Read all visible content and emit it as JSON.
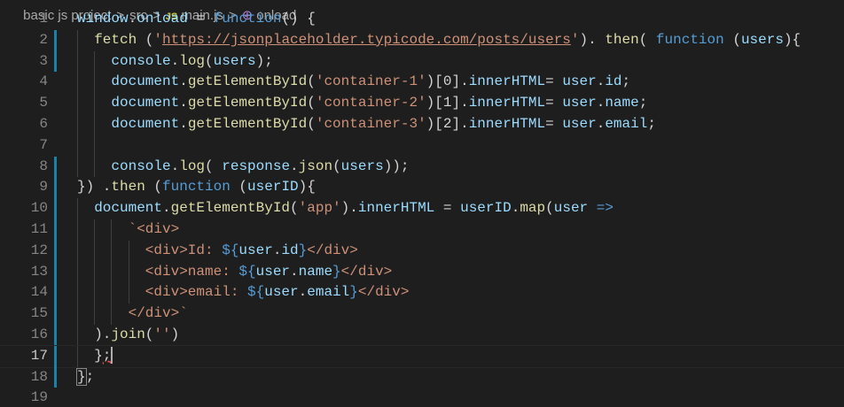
{
  "breadcrumb": {
    "items": [
      "basic js project",
      "src",
      "main.js",
      "onload"
    ],
    "file_icon": "JS",
    "symbol_icon": "method-icon"
  },
  "editor": {
    "active_line": 17,
    "modified_lines": [
      2,
      3,
      8,
      9,
      10,
      11,
      12,
      13,
      14,
      15,
      16,
      17,
      18
    ],
    "lines": [
      {
        "n": "1",
        "indent": 0,
        "t": [
          [
            "window",
            "var"
          ],
          [
            ".",
            "pun"
          ],
          [
            "onload",
            "var"
          ],
          [
            " = ",
            "pun"
          ],
          [
            "function",
            "kw"
          ],
          [
            "() ",
            "pun"
          ],
          [
            "{",
            "pun"
          ]
        ]
      },
      {
        "n": "2",
        "indent": 2,
        "t": [
          [
            "fetch",
            "fn"
          ],
          [
            " (",
            "pun"
          ],
          [
            "'",
            "str"
          ],
          [
            "https://jsonplaceholder.typicode.com/posts/users",
            "url"
          ],
          [
            "'",
            "str"
          ],
          [
            "). ",
            "pun"
          ],
          [
            "then",
            "fn"
          ],
          [
            "( ",
            "pun"
          ],
          [
            "function",
            "kw"
          ],
          [
            " (",
            "pun"
          ],
          [
            "users",
            "var"
          ],
          [
            "){",
            "pun"
          ]
        ]
      },
      {
        "n": "3",
        "indent": 4,
        "t": [
          [
            "console",
            "var"
          ],
          [
            ".",
            "pun"
          ],
          [
            "log",
            "fn"
          ],
          [
            "(",
            "pun"
          ],
          [
            "users",
            "var"
          ],
          [
            ");",
            "pun"
          ]
        ]
      },
      {
        "n": "4",
        "indent": 4,
        "t": [
          [
            "document",
            "var"
          ],
          [
            ".",
            "pun"
          ],
          [
            "getElementById",
            "fn"
          ],
          [
            "(",
            "pun"
          ],
          [
            "'container-1'",
            "str"
          ],
          [
            ")[0].",
            "pun"
          ],
          [
            "innerHTML",
            "var"
          ],
          [
            "= ",
            "pun"
          ],
          [
            "user",
            "var"
          ],
          [
            ".",
            "pun"
          ],
          [
            "id",
            "var"
          ],
          [
            ";",
            "pun"
          ]
        ]
      },
      {
        "n": "5",
        "indent": 4,
        "t": [
          [
            "document",
            "var"
          ],
          [
            ".",
            "pun"
          ],
          [
            "getElementById",
            "fn"
          ],
          [
            "(",
            "pun"
          ],
          [
            "'container-2'",
            "str"
          ],
          [
            ")[1].",
            "pun"
          ],
          [
            "innerHTML",
            "var"
          ],
          [
            "= ",
            "pun"
          ],
          [
            "user",
            "var"
          ],
          [
            ".",
            "pun"
          ],
          [
            "name",
            "var"
          ],
          [
            ";",
            "pun"
          ]
        ]
      },
      {
        "n": "6",
        "indent": 4,
        "t": [
          [
            "document",
            "var"
          ],
          [
            ".",
            "pun"
          ],
          [
            "getElementById",
            "fn"
          ],
          [
            "(",
            "pun"
          ],
          [
            "'container-3'",
            "str"
          ],
          [
            ")[2].",
            "pun"
          ],
          [
            "innerHTML",
            "var"
          ],
          [
            "= ",
            "pun"
          ],
          [
            "user",
            "var"
          ],
          [
            ".",
            "pun"
          ],
          [
            "email",
            "var"
          ],
          [
            ";",
            "pun"
          ]
        ]
      },
      {
        "n": "7",
        "indent": 0,
        "t": []
      },
      {
        "n": "8",
        "indent": 4,
        "t": [
          [
            "console",
            "var"
          ],
          [
            ".",
            "pun"
          ],
          [
            "log",
            "fn"
          ],
          [
            "( ",
            "pun"
          ],
          [
            "response",
            "var"
          ],
          [
            ".",
            "pun"
          ],
          [
            "json",
            "fn"
          ],
          [
            "(",
            "pun"
          ],
          [
            "users",
            "var"
          ],
          [
            "));",
            "pun"
          ]
        ]
      },
      {
        "n": "9",
        "indent": 0,
        "t": [
          [
            "}) .",
            "pun"
          ],
          [
            "then",
            "fn"
          ],
          [
            " (",
            "pun"
          ],
          [
            "function",
            "kw"
          ],
          [
            " (",
            "pun"
          ],
          [
            "userID",
            "var"
          ],
          [
            "){",
            "pun"
          ]
        ]
      },
      {
        "n": "10",
        "indent": 2,
        "t": [
          [
            "document",
            "var"
          ],
          [
            ".",
            "pun"
          ],
          [
            "getElementById",
            "fn"
          ],
          [
            "(",
            "pun"
          ],
          [
            "'app'",
            "str"
          ],
          [
            ").",
            "pun"
          ],
          [
            "innerHTML",
            "var"
          ],
          [
            " = ",
            "pun"
          ],
          [
            "userID",
            "var"
          ],
          [
            ".",
            "pun"
          ],
          [
            "map",
            "fn"
          ],
          [
            "(",
            "pun"
          ],
          [
            "user",
            "var"
          ],
          [
            " ",
            "pun"
          ],
          [
            "=>",
            "kw"
          ]
        ]
      },
      {
        "n": "11",
        "indent": 6,
        "t": [
          [
            "`<div>",
            "str"
          ]
        ]
      },
      {
        "n": "12",
        "indent": 8,
        "t": [
          [
            "<div>Id: ",
            "str"
          ],
          [
            "${",
            "kw"
          ],
          [
            "user",
            "var"
          ],
          [
            ".",
            "pun"
          ],
          [
            "id",
            "var"
          ],
          [
            "}",
            "kw"
          ],
          [
            "</div>",
            "str"
          ]
        ]
      },
      {
        "n": "13",
        "indent": 8,
        "t": [
          [
            "<div>name: ",
            "str"
          ],
          [
            "${",
            "kw"
          ],
          [
            "user",
            "var"
          ],
          [
            ".",
            "pun"
          ],
          [
            "name",
            "var"
          ],
          [
            "}",
            "kw"
          ],
          [
            "</div>",
            "str"
          ]
        ]
      },
      {
        "n": "14",
        "indent": 8,
        "t": [
          [
            "<div>email: ",
            "str"
          ],
          [
            "${",
            "kw"
          ],
          [
            "user",
            "var"
          ],
          [
            ".",
            "pun"
          ],
          [
            "email",
            "var"
          ],
          [
            "}",
            "kw"
          ],
          [
            "</div>",
            "str"
          ]
        ]
      },
      {
        "n": "15",
        "indent": 6,
        "t": [
          [
            "</div>`",
            "str"
          ]
        ]
      },
      {
        "n": "16",
        "indent": 2,
        "t": [
          [
            ").",
            "pun"
          ],
          [
            "join",
            "fn"
          ],
          [
            "(",
            "pun"
          ],
          [
            "''",
            "str"
          ],
          [
            ")",
            "pun"
          ]
        ]
      },
      {
        "n": "17",
        "indent": 2,
        "t": [
          [
            "}",
            "pun"
          ],
          [
            ";",
            "squig"
          ]
        ]
      },
      {
        "n": "18",
        "indent": 0,
        "t": [
          [
            "}",
            "brk"
          ],
          [
            ";",
            "pun"
          ]
        ]
      },
      {
        "n": "19",
        "indent": 0,
        "t": []
      }
    ]
  }
}
